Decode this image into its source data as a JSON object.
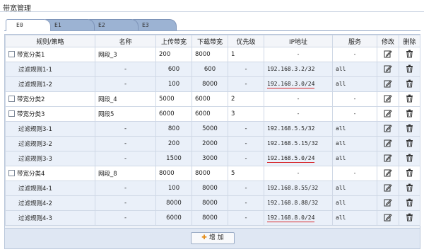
{
  "panel": {
    "title": "带宽管理"
  },
  "tabs": [
    {
      "label": "E0",
      "active": true
    },
    {
      "label": "E1",
      "active": false
    },
    {
      "label": "E2",
      "active": false
    },
    {
      "label": "E3",
      "active": false
    }
  ],
  "table": {
    "headers": {
      "rule": "规则/策略",
      "name": "名称",
      "up": "上传带宽",
      "down": "下载带宽",
      "priority": "优先级",
      "ip": "IP地址",
      "service": "服务",
      "edit": "修改",
      "delete": "删除"
    },
    "groups": [
      {
        "label": "带宽分类1",
        "name": "网段_3",
        "up": "200",
        "down": "8000",
        "priority": "1",
        "ip": "-",
        "service": "-",
        "rules": [
          {
            "label": "过滤规则1-1",
            "name": "-",
            "up": "600",
            "down": "600",
            "priority": "-",
            "ip": "192.168.3.2/32",
            "service": "all",
            "flag": false
          },
          {
            "label": "过滤规则1-2",
            "name": "-",
            "up": "100",
            "down": "8000",
            "priority": "-",
            "ip": "192.168.3.0/24",
            "service": "all",
            "flag": true
          }
        ]
      },
      {
        "label": "带宽分类2",
        "name": "网段_4",
        "up": "5000",
        "down": "6000",
        "priority": "2",
        "ip": "-",
        "service": "-",
        "rules": []
      },
      {
        "label": "带宽分类3",
        "name": "网段5",
        "up": "6000",
        "down": "6000",
        "priority": "3",
        "ip": "-",
        "service": "-",
        "rules": [
          {
            "label": "过滤规则3-1",
            "name": "-",
            "up": "800",
            "down": "5000",
            "priority": "-",
            "ip": "192.168.5.5/32",
            "service": "all",
            "flag": false
          },
          {
            "label": "过滤规则3-2",
            "name": "-",
            "up": "200",
            "down": "2000",
            "priority": "-",
            "ip": "192.168.5.15/32",
            "service": "all",
            "flag": false
          },
          {
            "label": "过滤规则3-3",
            "name": "-",
            "up": "1500",
            "down": "3000",
            "priority": "-",
            "ip": "192.168.5.0/24",
            "service": "all",
            "flag": true
          }
        ]
      },
      {
        "label": "带宽分类4",
        "name": "网段_8",
        "up": "8000",
        "down": "8000",
        "priority": "5",
        "ip": "-",
        "service": "-",
        "rules": [
          {
            "label": "过滤规则4-1",
            "name": "-",
            "up": "100",
            "down": "8000",
            "priority": "-",
            "ip": "192.168.8.55/32",
            "service": "all",
            "flag": false
          },
          {
            "label": "过滤规则4-2",
            "name": "-",
            "up": "8000",
            "down": "8000",
            "priority": "-",
            "ip": "192.168.8.88/32",
            "service": "all",
            "flag": false
          },
          {
            "label": "过滤规则4-3",
            "name": "-",
            "up": "6000",
            "down": "8000",
            "priority": "-",
            "ip": "192.168.8.0/24",
            "service": "all",
            "flag": true
          }
        ]
      }
    ]
  },
  "footer": {
    "add_label": "增 加"
  },
  "colors": {
    "flag_underline": "#d7262b",
    "header_bg": "#f3f5f9",
    "rule_row_bg": "#eaf0f9",
    "tab_bg": "#9cb3d3",
    "add_icon": "#e38a12"
  },
  "icons": {
    "edit": "pencil-icon",
    "delete": "trash-icon",
    "add": "plus-icon"
  }
}
